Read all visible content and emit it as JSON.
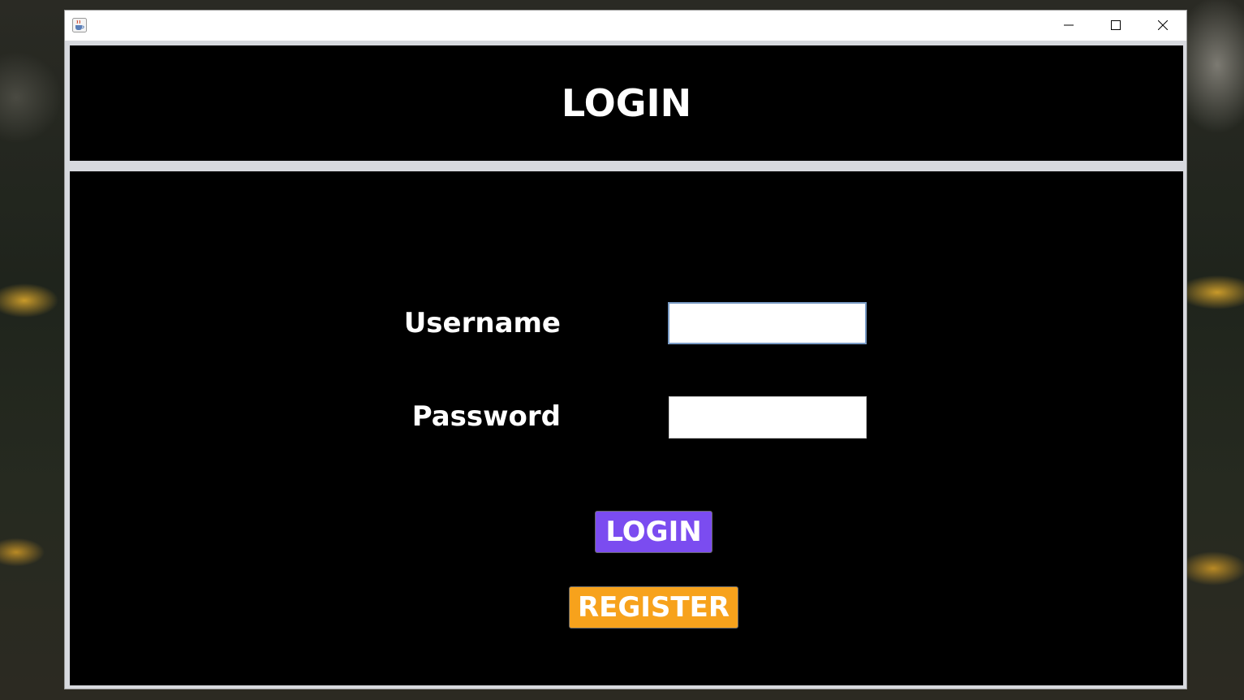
{
  "window": {
    "title": "",
    "controls": {
      "minimize_icon": "minimize-icon",
      "maximize_icon": "maximize-icon",
      "close_icon": "close-icon"
    },
    "app_icon": "java-cup-icon"
  },
  "header": {
    "title": "LOGIN"
  },
  "form": {
    "username_label": "Username",
    "username_value": "",
    "password_label": "Password",
    "password_value": ""
  },
  "buttons": {
    "login_label": "LOGIN",
    "register_label": "REGISTER"
  },
  "colors": {
    "panel_bg": "#000000",
    "login_button": "#7b4cf0",
    "register_button": "#f7a21c",
    "text": "#ffffff",
    "frame": "#d7d9de"
  }
}
